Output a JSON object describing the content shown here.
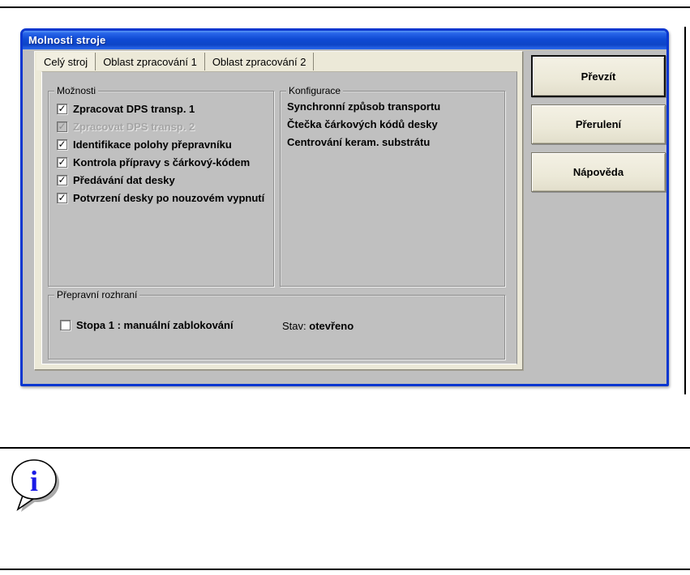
{
  "window": {
    "title": "Molnosti stroje"
  },
  "tabs": [
    {
      "label": "Celý stroj",
      "active": true
    },
    {
      "label": "Oblast zpracování 1",
      "active": false
    },
    {
      "label": "Oblast zpracování 2",
      "active": false
    }
  ],
  "groups": {
    "moznosti": {
      "label": "Možnosti",
      "options": [
        {
          "label": "Zpracovat DPS transp. 1",
          "checked": true,
          "disabled": false
        },
        {
          "label": "Zpracovat DPS transp. 2",
          "checked": true,
          "disabled": true
        },
        {
          "label": "Identifikace polohy přepravníku",
          "checked": true,
          "disabled": false
        },
        {
          "label": "Kontrola přípravy s čárkový-kódem",
          "checked": true,
          "disabled": false
        },
        {
          "label": "Předávání dat desky",
          "checked": true,
          "disabled": false
        },
        {
          "label": "Potvrzení desky po nouzovém vypnutí",
          "checked": true,
          "disabled": false
        }
      ]
    },
    "konfigurace": {
      "label": "Konfigurace",
      "items": [
        "Synchronní způsob transportu",
        "Čtečka čárkových kódů desky",
        "Centrování keram. substrátu"
      ]
    },
    "prepravni": {
      "label": "Přepravní rozhraní",
      "option": {
        "label": "Stopa 1 : manuální zablokování",
        "checked": false
      },
      "status_label": "Stav:",
      "status_value": "otevřeno"
    }
  },
  "buttons": [
    {
      "label": "Převzít",
      "default": true
    },
    {
      "label": "Přerulení",
      "default": false
    },
    {
      "label": "Nápověda",
      "default": false
    }
  ],
  "icons": {
    "info": "info-speech-bubble"
  },
  "colors": {
    "titlebar_blue": "#0f4ad4",
    "dialog_border_blue": "#0a37d0",
    "dialog_gray": "#bfbfbf",
    "panel_beige": "#ece9d8",
    "page_gray": "#c0c0c0",
    "disabled_text": "#a5a5a5",
    "info_i_blue": "#1a1ae6"
  }
}
